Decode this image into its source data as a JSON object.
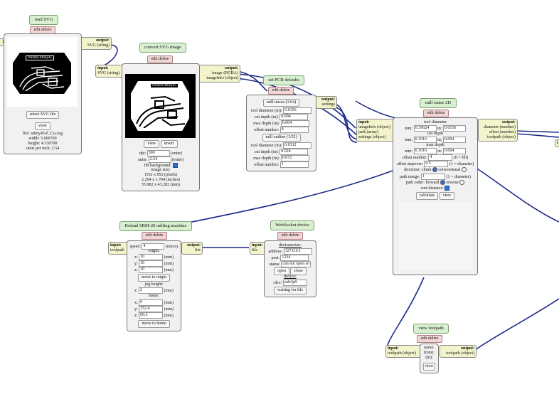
{
  "colors": {
    "wire": "#1c2a8a",
    "title_bg": "#d8efd0",
    "edit_bg": "#f2d6d6",
    "port_bg": "#f4f4cc",
    "module_bg": "#f1f1f1"
  },
  "common": {
    "edit_delete": "edit delete",
    "input": "input:",
    "output": "output:"
  },
  "read_svg": {
    "title": "read SVG",
    "output_type": "SVG (string)",
    "board_label": "Parallel Attiny45",
    "select_button": "select SVG file",
    "view_button": "view",
    "file": "file: attiny45-F_Cu.svg",
    "width": "width: 5.600700",
    "height": "height: 4.330700",
    "units": "units per inch: 2.54"
  },
  "convert_svg": {
    "title": "convert SVG image",
    "input_type": "SVG (string)",
    "output_types": [
      "image (RGBA)",
      "imageInfo (object)"
    ],
    "board_label": "Parallel Attiny45",
    "view_button": "view",
    "invert_button": "invert",
    "dpi_label": "dpi:",
    "dpi_value": "500",
    "dpi_hint": "(enter)",
    "units_label": "units:",
    "units_value": "2.54",
    "units_hint": "(enter)",
    "fill_label": "fill background:",
    "size_title": "image size:",
    "size_px": "1102 x 852 (pixels)",
    "size_in": "2.204 x 1.704 (inches)",
    "size_mm": "55.982 x 43.282 (mm)"
  },
  "pcb_defaults": {
    "title": "set PCB defaults",
    "output_type": "settings",
    "traces_button": "mill traces (1/64)",
    "outline_button": "mill outline (1/32)",
    "traces": [
      {
        "label": "tool diameter (in):",
        "value": "0.0156"
      },
      {
        "label": "cut depth (in):",
        "value": "0.004"
      },
      {
        "label": "max depth (in):",
        "value": "0.004"
      },
      {
        "label": "offset number:",
        "value": "4"
      }
    ],
    "outline": [
      {
        "label": "tool diameter (in):",
        "value": "0.0312"
      },
      {
        "label": "cut depth (in):",
        "value": "0.024"
      },
      {
        "label": "max depth (in):",
        "value": "0.072"
      },
      {
        "label": "offset number:",
        "value": "1"
      }
    ]
  },
  "mill_raster": {
    "title": "mill raster 2D",
    "input_types": [
      "imageInfo (object)",
      "path (array)",
      "settings (object)"
    ],
    "output_types": [
      "diameter (number)",
      "offset (number)",
      "toolpath (object)"
    ],
    "tool_diameter": "tool diameter",
    "td_mm": "0.39624",
    "td_in": "0.0156",
    "cut_depth": "cut depth",
    "cd_mm": "0.1016",
    "cd_in": "0.004",
    "max_depth": "max depth",
    "md_mm": "0.1016",
    "md_in": "0.004",
    "mm_label": "mm:",
    "in_label": "in:",
    "offset_number_label": "offset number:",
    "offset_number": "4",
    "offset_number_hint": "(0 = fill)",
    "stepover_label": "offset stepover:",
    "stepover": "0.5",
    "stepover_hint": "(1 = diameter)",
    "direction_label": "direction: climb",
    "direction_conventional": "conventional",
    "merge_label": "path merge:",
    "merge": "1",
    "merge_hint": "(1 = diameter)",
    "order_label": "path order: forward",
    "order_reverse": "reverse",
    "sort_label": "sort distance:",
    "calculate_button": "calculate",
    "view_button": "view"
  },
  "roland": {
    "title": "Roland SRM-20 milling machine",
    "input_type": "toolpath",
    "output_type": "file",
    "speed_label": "speed:",
    "speed": "4",
    "speed_unit": "(mm/s)",
    "origin": "origin:",
    "ox": "10",
    "oy": "10",
    "oz": "10",
    "mm": "(mm)",
    "move_origin": "move to origin",
    "jog": "jog height:",
    "jog_z": "2",
    "home": "home:",
    "hx": "0",
    "hy": "152.4",
    "hz": "60.5",
    "move_home": "move to home",
    "x": "x:",
    "y": "y:",
    "z": "z:"
  },
  "websocket": {
    "title": "WebSocket device",
    "input_type": "file",
    "deviceserver": "deviceserver:",
    "address_label": "address:",
    "address": "127.0.0.1",
    "port_label": "port:",
    "port": "1234",
    "status_label": "status:",
    "status": "can not open so",
    "open_button": "open",
    "close_button": "close",
    "device": "device:",
    "dev_label": "/dev/",
    "dev": "usb/lp0",
    "waiting_button": "waiting for file"
  },
  "view_toolpath": {
    "title": "view toolpath",
    "input_type": "toolpath (object)",
    "output_type": "toolpath (object)",
    "name_lines": [
      "name:",
      "(mm):",
      "(in):"
    ],
    "view_button": "view"
  },
  "left_stub": {
    "text": ")"
  },
  "right_stub": {
    "text": "i"
  }
}
